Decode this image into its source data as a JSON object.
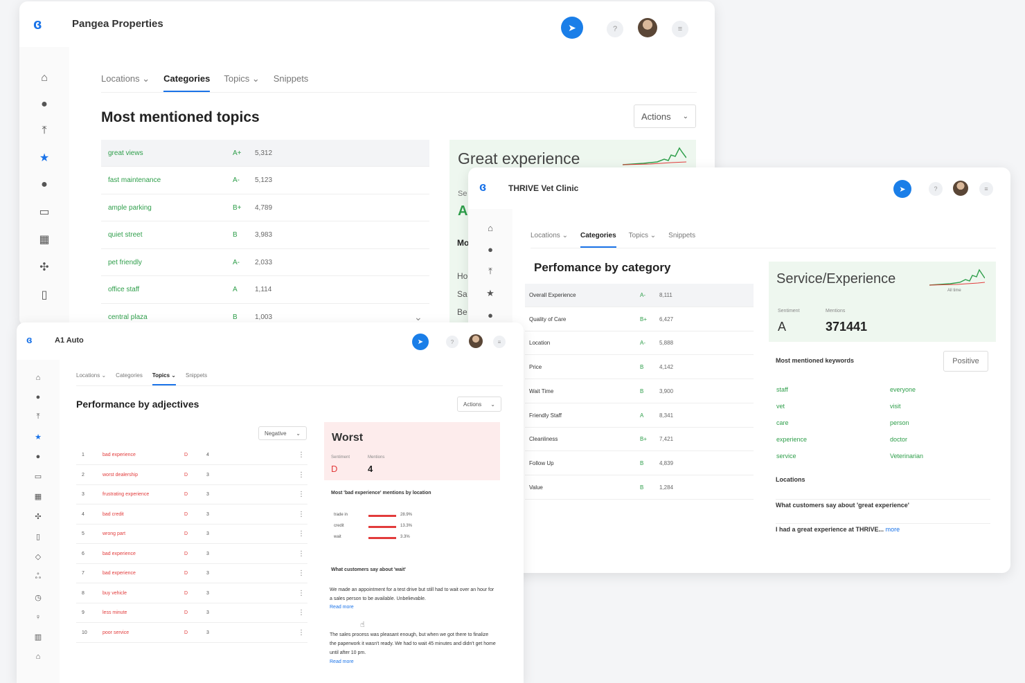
{
  "win1": {
    "app_name": "Pangea Properties",
    "tabs": [
      "Locations ⌄",
      "Categories",
      "Topics ⌄",
      "Snippets"
    ],
    "title": "Most mentioned topics",
    "actions_label": "Actions",
    "rows": [
      {
        "label": "great views",
        "grade": "A+",
        "count": "5,312"
      },
      {
        "label": "fast maintenance",
        "grade": "A-",
        "count": "5,123"
      },
      {
        "label": "ample parking",
        "grade": "B+",
        "count": "4,789"
      },
      {
        "label": "quiet street",
        "grade": "B",
        "count": "3,983"
      },
      {
        "label": "pet friendly",
        "grade": "A-",
        "count": "2,033"
      },
      {
        "label": "office staff",
        "grade": "A",
        "count": "1,114"
      },
      {
        "label": "central plaza",
        "grade": "B",
        "count": "1,003"
      }
    ],
    "card_title": "Great experience",
    "card_grade": "A",
    "partial": {
      "se": "Se",
      "mo": "Mo",
      "ho": "Ho",
      "sa": "Sa",
      "be": "Be"
    }
  },
  "win2": {
    "app_name": "THRIVE Vet Clinic",
    "tabs": [
      "Locations ⌄",
      "Categories",
      "Topics ⌄",
      "Snippets"
    ],
    "title": "Perfomance by category",
    "rows": [
      {
        "label": "Overall Experience",
        "grade": "A-",
        "count": "8,111"
      },
      {
        "label": "Quality of Care",
        "grade": "B+",
        "count": "6,427"
      },
      {
        "label": "Location",
        "grade": "A-",
        "count": "5,888"
      },
      {
        "label": "Price",
        "grade": "B",
        "count": "4,142"
      },
      {
        "label": "Wait Time",
        "grade": "B",
        "count": "3,900"
      },
      {
        "label": "Friendly Staff",
        "grade": "A",
        "count": "8,341"
      },
      {
        "label": "Cleanliness",
        "grade": "B+",
        "count": "7,421"
      },
      {
        "label": "Follow Up",
        "grade": "B",
        "count": "4,839"
      },
      {
        "label": "Value",
        "grade": "B",
        "count": "1,284"
      }
    ],
    "card": {
      "title": "Service/Experience",
      "range": "All time",
      "sentiment_label": "Sentiment",
      "mentions_label": "Mentions",
      "sentiment": "A",
      "mentions": "371441"
    },
    "keywords_title": "Most mentioned keywords",
    "filter": "Positive",
    "keywords_left": [
      "staff",
      "vet",
      "care",
      "experience",
      "service"
    ],
    "keywords_right": [
      "everyone",
      "visit",
      "person",
      "doctor",
      "Veterinarian"
    ],
    "locations_label": "Locations",
    "quote_title": "What customers say about 'great experience'",
    "quote_text": "I had a great experience at THRIVE...",
    "more": "more"
  },
  "win3": {
    "app_name": "A1 Auto",
    "tabs": [
      "Locations ⌄",
      "Categories",
      "Topics ⌄",
      "Snippets"
    ],
    "title": "Performance by adjectives",
    "actions_label": "Actions",
    "filter": "Negative",
    "rows": [
      {
        "n": "1",
        "label": "bad experience",
        "grade": "D",
        "count": "4"
      },
      {
        "n": "2",
        "label": "worst dealership",
        "grade": "D",
        "count": "3"
      },
      {
        "n": "3",
        "label": "frustrating experience",
        "grade": "D",
        "count": "3"
      },
      {
        "n": "4",
        "label": "bad credit",
        "grade": "D",
        "count": "3"
      },
      {
        "n": "5",
        "label": "wrong part",
        "grade": "D",
        "count": "3"
      },
      {
        "n": "6",
        "label": "bad experience",
        "grade": "D",
        "count": "3"
      },
      {
        "n": "7",
        "label": "bad experience",
        "grade": "D",
        "count": "3"
      },
      {
        "n": "8",
        "label": "buy vehicle",
        "grade": "D",
        "count": "3"
      },
      {
        "n": "9",
        "label": "less minute",
        "grade": "D",
        "count": "3"
      },
      {
        "n": "10",
        "label": "poor service",
        "grade": "D",
        "count": "3"
      }
    ],
    "card": {
      "title": "Worst",
      "sentiment_label": "Sentiment",
      "mentions_label": "Mentions",
      "sentiment": "D",
      "mentions": "4"
    },
    "by_location_title": "Most 'bad experience' mentions by location",
    "bars": [
      {
        "label": "trade in",
        "pct": "28.9%",
        "frac": 0.289
      },
      {
        "label": "credit",
        "pct": "13.3%",
        "frac": 0.133
      },
      {
        "label": "wait",
        "pct": "3.3%",
        "frac": 0.033
      }
    ],
    "quote_title": "What customers say about 'wait'",
    "quote1": "We made an appointment for a test drive but still had to wait over an hour for a sales person to be available. Unbelievable.",
    "quote2": "The sales process was pleasant enough, but when we got there to finalize the paperwork it wasn't ready. We had to wait 45 minutes and didn't get home until after 10 pm.",
    "read_more": "Read more"
  }
}
